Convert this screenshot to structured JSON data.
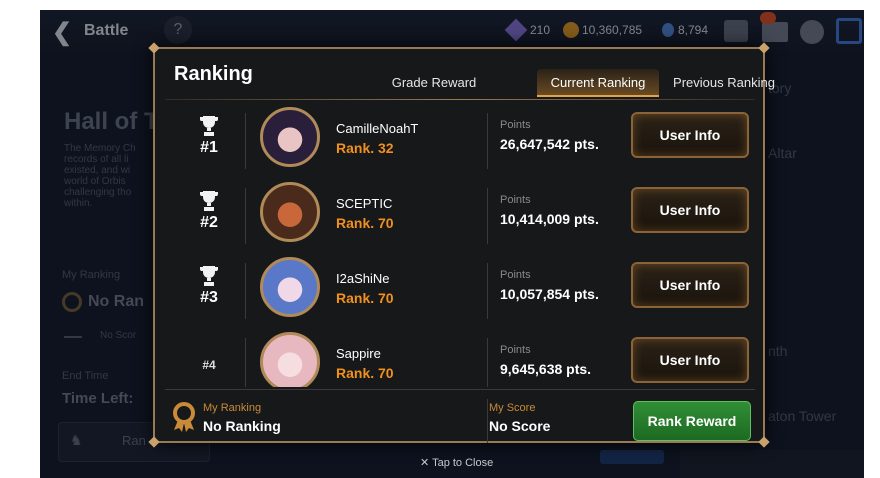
{
  "topbar": {
    "back_label": "Battle",
    "help_label": "?",
    "currency1": "210",
    "currency2": "10,360,785",
    "currency3": "8,794"
  },
  "background": {
    "title": "Hall of T",
    "desc": [
      "The Memory Ch",
      "records of all li",
      "existed, and wi",
      "world of Orbis",
      "challenging tho",
      "within."
    ],
    "my_ranking_label": "My Ranking",
    "my_ranking_value": "No Ran",
    "no_score": "No Scor",
    "end_time_label": "End Time",
    "time_left": "Time Left:",
    "rank_btn": "Ran",
    "right_items": [
      "tory",
      "Altar",
      "nth",
      "aton Tower"
    ]
  },
  "modal": {
    "title": "Ranking",
    "tabs": [
      "Grade Reward",
      "Current Ranking",
      "Previous Ranking"
    ],
    "active_tab": 1,
    "rows": [
      {
        "position": "#1",
        "name": "CamilleNoahT",
        "rank": "Rank.  32",
        "points_label": "Points",
        "points": "26,647,542 pts.",
        "button": "User Info",
        "trophy": true
      },
      {
        "position": "#2",
        "name": "SCEPTIC",
        "rank": "Rank.  70",
        "points_label": "Points",
        "points": "10,414,009 pts.",
        "button": "User Info",
        "trophy": true
      },
      {
        "position": "#3",
        "name": "I2aShiNe",
        "rank": "Rank.  70",
        "points_label": "Points",
        "points": "10,057,854 pts.",
        "button": "User Info",
        "trophy": true
      },
      {
        "position": "#4",
        "name": "Sappire",
        "rank": "Rank.  70",
        "points_label": "Points",
        "points": "9,645,638 pts.",
        "button": "User Info",
        "trophy": false
      }
    ],
    "footer": {
      "my_ranking_label": "My Ranking",
      "my_ranking_value": "No Ranking",
      "my_score_label": "My Score",
      "my_score_value": "No Score",
      "reward_button": "Rank Reward"
    }
  },
  "tap_to_close": "✕ Tap to Close",
  "colors": {
    "accent": "#f0911f",
    "gold": "#9a7a52",
    "green": "#2f8f35"
  }
}
